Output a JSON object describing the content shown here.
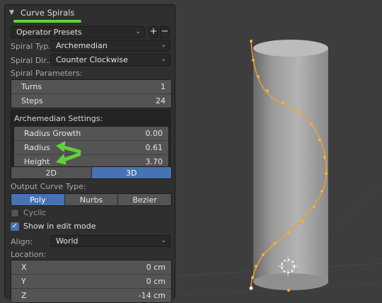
{
  "panel": {
    "title": "Curve Spirals",
    "presets": {
      "label": "Operator Presets",
      "add": "+",
      "remove": "−"
    },
    "spiral_type": {
      "label": "Spiral Typ...",
      "value": "Archemedian"
    },
    "spiral_dir": {
      "label": "Spiral Dir...",
      "value": "Counter Clockwise"
    },
    "spiral_params_label": "Spiral Parameters:",
    "turns": {
      "label": "Turns",
      "value": "1"
    },
    "steps": {
      "label": "Steps",
      "value": "24"
    },
    "arch_settings_label": "Archemedian Settings:",
    "radius_growth": {
      "label": "Radius Growth",
      "value": "0.00"
    },
    "radius": {
      "label": "Radius",
      "value": "0.61"
    },
    "height": {
      "label": "Height",
      "value": "3.70"
    },
    "dim_toggle": {
      "options": [
        "2D",
        "3D"
      ],
      "selected": "3D"
    },
    "output_label": "Output Curve Type:",
    "curve_types": {
      "options": [
        "Poly",
        "Nurbs",
        "Bezier"
      ],
      "selected": "Poly"
    },
    "cyclic": {
      "label": "Cyclic",
      "checked": false
    },
    "edit_mode": {
      "label": "Show in edit mode",
      "checked": true
    },
    "align": {
      "label": "Align:",
      "value": "World"
    },
    "location_label": "Location:",
    "location": [
      {
        "axis": "X",
        "value": "0 cm"
      },
      {
        "axis": "Y",
        "value": "0 cm"
      },
      {
        "axis": "Z",
        "value": "-14 cm"
      }
    ]
  },
  "colors": {
    "accent": "#4772b3",
    "annotation": "#5fd13a",
    "curve": "#f0a030"
  },
  "icons": [
    "chevron-down-icon",
    "dropdown-arrow-icon",
    "checkmark-icon",
    "3d-cursor-icon"
  ]
}
